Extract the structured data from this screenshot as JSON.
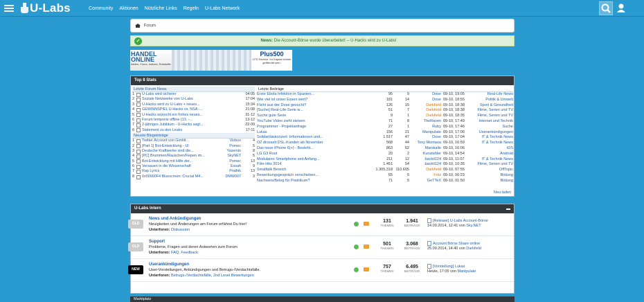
{
  "header": {
    "logo_text": "U-Labs",
    "nav": [
      "Community",
      "Aktionen",
      "Nützliche Links",
      "Regeln",
      "U-Labs Network"
    ]
  },
  "breadcrumb": {
    "label": "Forum"
  },
  "news": {
    "label": "News:",
    "text": "Die Account-Börse wurde überarbeitet! -- U-Hacks wird zu U-Labs!"
  },
  "ad": {
    "left_title": "HANDEL ONLINE",
    "left_sub": "Aktien, Forex, Indizes, Rohstoffe",
    "right_title": "Plus500",
    "right_sub": "CFD Service. Ihr Kapital könnte gefährdet sein."
  },
  "stats": {
    "title": "Top 8 Stats",
    "forum_news_header": "Letzte Forum News",
    "forum_news": [
      {
        "n": "1",
        "title": "U-Labs wird sicherer",
        "user": "",
        "time": "04:05"
      },
      {
        "n": "2",
        "title": "Soziale Netzwerke von U-Labs",
        "user": "",
        "time": "17:04"
      },
      {
        "n": "3",
        "title": "U-Hacks wird zu U-Labs + neues...",
        "user": "",
        "time": "15:34"
      },
      {
        "n": "4",
        "title": "GEWINNSPIEL U-Hacks vs. NSA -...",
        "user": "",
        "time": "21:08"
      },
      {
        "n": "5",
        "title": "U-Hacks wünscht ein frohes neues...",
        "user": "",
        "time": "31-12"
      },
      {
        "n": "6",
        "title": "Forum temporär offline (13. -...",
        "user": "",
        "time": "13-12"
      },
      {
        "n": "7",
        "title": "2-jähriges Jubiläum - U-Hacks sagt...",
        "user": "",
        "time": "22-09"
      },
      {
        "n": "8",
        "title": "Statement zu den Leaks",
        "user": "",
        "time": "17-11"
      }
    ],
    "blog_header": "Neuste Blogeinträge",
    "blog": [
      {
        "n": "1",
        "title": "Twitter Account von Gimlitt...",
        "user": "Viobus",
        "time": "4"
      },
      {
        "n": "2",
        "title": "[Part 1] Bot-Entwicklung - UI",
        "user": "Pomec",
        "time": "5"
      },
      {
        "n": "3",
        "title": "Deutsche Kraftwerke sind die...",
        "user": "Yasemin",
        "time": "8"
      },
      {
        "n": "4",
        "title": "[PC] Brummen/Rauschen/Fiepen im...",
        "user": "SkyNET",
        "time": "5"
      },
      {
        "n": "5",
        "title": "Bot-Entwicklung mit Hilfe der...",
        "user": "Pomec",
        "time": "13"
      },
      {
        "n": "6",
        "title": "Versauen in die Wissenschaft",
        "user": "Essah",
        "time": "9"
      },
      {
        "n": "7",
        "title": "Rap Lyrics",
        "user": "Prathik",
        "time": "13"
      },
      {
        "n": "8",
        "title": "0x00000F4 Bluescreen: Crucial M4...",
        "user": "DMW007",
        "time": "3"
      }
    ],
    "recent_header": "Letzte Beiträge",
    "recent": [
      {
        "title": "Erste Ebola Infektion in Spanien...",
        "a": "95",
        "b": "9",
        "user": "Dose",
        "uo": false,
        "date": "09-10, 19:05",
        "forum": "Real-Life News"
      },
      {
        "title": "Wie viel ist unser Essen wert?",
        "a": "181",
        "b": "14",
        "user": "Dose",
        "uo": false,
        "date": "09-10, 18:55",
        "forum": "Politik & Umwelt"
      },
      {
        "title": "Flicht aus der Dose gesucht?",
        "a": "126",
        "b": "15",
        "user": "Darkfield",
        "uo": true,
        "date": "09-10, 18:38",
        "forum": "Sport & Gesundheit"
      },
      {
        "title": "[Suche] Real-Life-Serie w...",
        "a": "51",
        "b": "7",
        "user": "Darkfield",
        "uo": true,
        "date": "09-10, 18:38",
        "forum": "Filme, Serien und TV"
      },
      {
        "title": "Suche gute Serie",
        "a": "9",
        "b": "1",
        "user": "Darkfield",
        "uo": true,
        "date": "09-10, 18:35",
        "forum": "Filme, Serien und TV"
      },
      {
        "title": "YouTube Video zieht stetsen",
        "a": "71",
        "b": "8",
        "user": "TheRaven",
        "uo": false,
        "date": "09-10, 17:49",
        "forum": "Internet und Technik"
      },
      {
        "title": "Programmer - Projektanfrage",
        "a": "27",
        "b": "1",
        "user": "Ruby",
        "uo": false,
        "date": "09-10, 17:46",
        "forum": "Suche"
      },
      {
        "title": "Lukas",
        "a": "156",
        "b": "21",
        "user": "Manipulate",
        "uo": false,
        "date": "09-10, 17:06",
        "forum": "Userankündigungen"
      },
      {
        "title": "Solidaritäskonzert: Informationen und...",
        "a": "1.517",
        "b": "47",
        "user": "Dose",
        "uo": false,
        "date": "09-10, 17:04",
        "forum": "IT & Technik News"
      },
      {
        "title": "O2 drosselt DSL-Kunden ab November",
        "a": "568",
        "b": "44",
        "user": "Tony Montana",
        "uo": false,
        "date": "09-10, 16:59",
        "forum": "IT & Technik News"
      },
      {
        "title": "Das neue iPhone 6(+) - Besteht...",
        "a": "863",
        "b": "62",
        "user": "Marskalle",
        "uo": false,
        "date": "09-10, 16:06",
        "forum": "iOS"
      },
      {
        "title": "LG G3 Root",
        "a": "20",
        "b": "2",
        "user": "Kunstehler",
        "uo": false,
        "date": "09-10, 14:54",
        "forum": "Android"
      },
      {
        "title": "Modulares Smartphone seit Anfang...",
        "a": "211",
        "b": "12",
        "user": "backtl124",
        "uo": false,
        "date": "09-10, 11:07",
        "forum": "IT & Technik News"
      },
      {
        "title": "Film-Hits 2014",
        "a": "1.451",
        "b": "54",
        "user": "backtl124",
        "uo": false,
        "date": "09-10, 10:35",
        "forum": "Filme, Serien und TV"
      },
      {
        "title": "Smalltalk Bereich",
        "a": "1.305.318",
        "b": "110.605",
        "user": "Darkfield",
        "uo": true,
        "date": "09-10, 07:55",
        "forum": "OffTopic"
      },
      {
        "title": "Bewerbungsgespräch verschieben...",
        "a": "65",
        "b": "5",
        "user": "Fritz",
        "uo": true,
        "date": "09-10, 06:23",
        "forum": "Bildung"
      },
      {
        "title": "Nachweis/Beleg für Praktikum?",
        "a": "71",
        "b": "5",
        "user": "GeTTeX",
        "uo": false,
        "date": "09-10, 01:50",
        "forum": "Bildung"
      }
    ],
    "more_label": "Neu laden"
  },
  "intern": {
    "title": "U-Labs Intern",
    "forums": [
      {
        "badge": "OLD",
        "badge_type": "old",
        "name": "News und Ankündigungen",
        "desc": "Neuigkeiten und Änderungen am Forum erfährst Du hier!",
        "sub_label": "Unterforen:",
        "sub": "Diskussion",
        "themen": "131",
        "themen_label": "THEMEN",
        "beitraege": "1.941",
        "beitraege_label": "BEITRÄGE",
        "last_title": "[Release] U-Labs Account-Börse",
        "last_meta": "14.09.2014, 12:41 von",
        "last_user": "Sky.NET"
      },
      {
        "badge": "OLD",
        "badge_type": "old",
        "name": "Support",
        "desc": "Probleme, Fragen und deren Antworten zum Forum",
        "sub_label": "Unterforen:",
        "sub": "FAQ, Feedback",
        "themen": "501",
        "themen_label": "THEMEN",
        "beitraege": "3.068",
        "beitraege_label": "BEITRÄGE",
        "last_title": "Account Börse Share online",
        "last_meta": "25.09.2014, 14:40 von",
        "last_user": "Darkfield"
      },
      {
        "badge": "NEW",
        "badge_type": "new",
        "name": "Userankündigungen",
        "desc": "User-Vorstellungen, Ankündigungen und Betrugs-/Verdachtsfälle.",
        "sub_label": "Unterforen:",
        "sub": "Betrugs-/Verdachtsfälle, 2nd Level Bewertungen",
        "themen": "757",
        "themen_label": "THEMEN",
        "beitraege": "6.495",
        "beitraege_label": "BEITRÄGE",
        "last_title": "[Vorstellung] Lukas",
        "last_meta": "Heute, 17:05 von",
        "last_user": "Manipulate"
      }
    ]
  },
  "bottom_panel": {
    "title": "Marktplatz"
  }
}
